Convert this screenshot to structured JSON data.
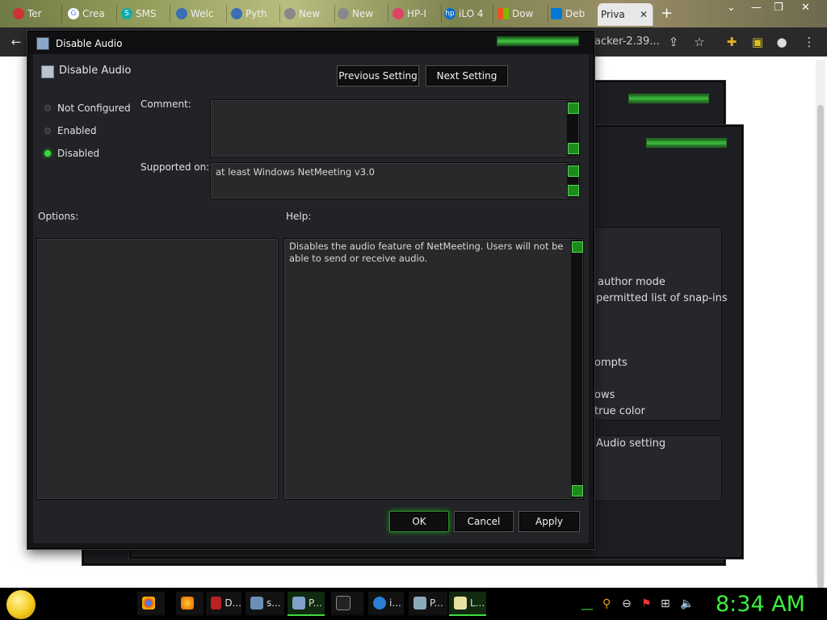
{
  "browser": {
    "tabs": [
      {
        "label": "Ter",
        "icon": "tab-icon"
      },
      {
        "label": "Crea",
        "icon": "google-icon"
      },
      {
        "label": "SMS",
        "icon": "sms-icon"
      },
      {
        "label": "Welc",
        "icon": "python-icon"
      },
      {
        "label": "Pyth",
        "icon": "python-icon"
      },
      {
        "label": "New",
        "icon": "chrome-icon"
      },
      {
        "label": "New",
        "icon": "chrome-icon"
      },
      {
        "label": "HP-I",
        "icon": "hp-icon"
      },
      {
        "label": "iLO 4",
        "icon": "hp-icon"
      },
      {
        "label": "Dow",
        "icon": "microsoft-icon"
      },
      {
        "label": "Deb",
        "icon": "vscode-icon"
      },
      {
        "label": "Priva",
        "icon": "tab-icon",
        "active": true
      }
    ],
    "address_tail": "acker-2.39..."
  },
  "background_window": {
    "items": [
      "author mode",
      "permitted list of snap-ins",
      "ompts",
      "ows",
      "true color"
    ],
    "description": "Audio setting"
  },
  "dialog": {
    "title": "Disable Audio",
    "header": "Disable Audio",
    "buttons": {
      "previous": "Previous Setting",
      "next": "Next Setting",
      "ok": "OK",
      "cancel": "Cancel",
      "apply": "Apply"
    },
    "options": [
      {
        "label": "Not Configured",
        "selected": false
      },
      {
        "label": "Enabled",
        "selected": false
      },
      {
        "label": "Disabled",
        "selected": true
      }
    ],
    "comment_label": "Comment:",
    "comment_value": "",
    "supported_label": "Supported on:",
    "supported_value": "at least Windows NetMeeting v3.0",
    "options_label": "Options:",
    "help_label": "Help:",
    "help_text": "Disables the audio feature of NetMeeting.  Users will not be able to send or receive audio."
  },
  "taskbar": {
    "items": [
      {
        "label": "",
        "icon": "chrome-icon"
      },
      {
        "label": "",
        "icon": "firefox-icon"
      },
      {
        "label": "D...",
        "icon": "document-icon"
      },
      {
        "label": "s...",
        "icon": "console-icon"
      },
      {
        "label": "P...",
        "icon": "policy-icon",
        "active": true
      },
      {
        "label": "",
        "icon": "cmd-icon"
      },
      {
        "label": "i...",
        "icon": "ie-icon"
      },
      {
        "label": "P...",
        "icon": "remote-desktop-icon"
      },
      {
        "label": "L...",
        "icon": "notepad-icon",
        "active": true
      }
    ],
    "clock": "8:34 AM"
  },
  "colors": {
    "accent": "#3cf03c",
    "dialog_bg": "#222326",
    "frame": "#151517"
  }
}
